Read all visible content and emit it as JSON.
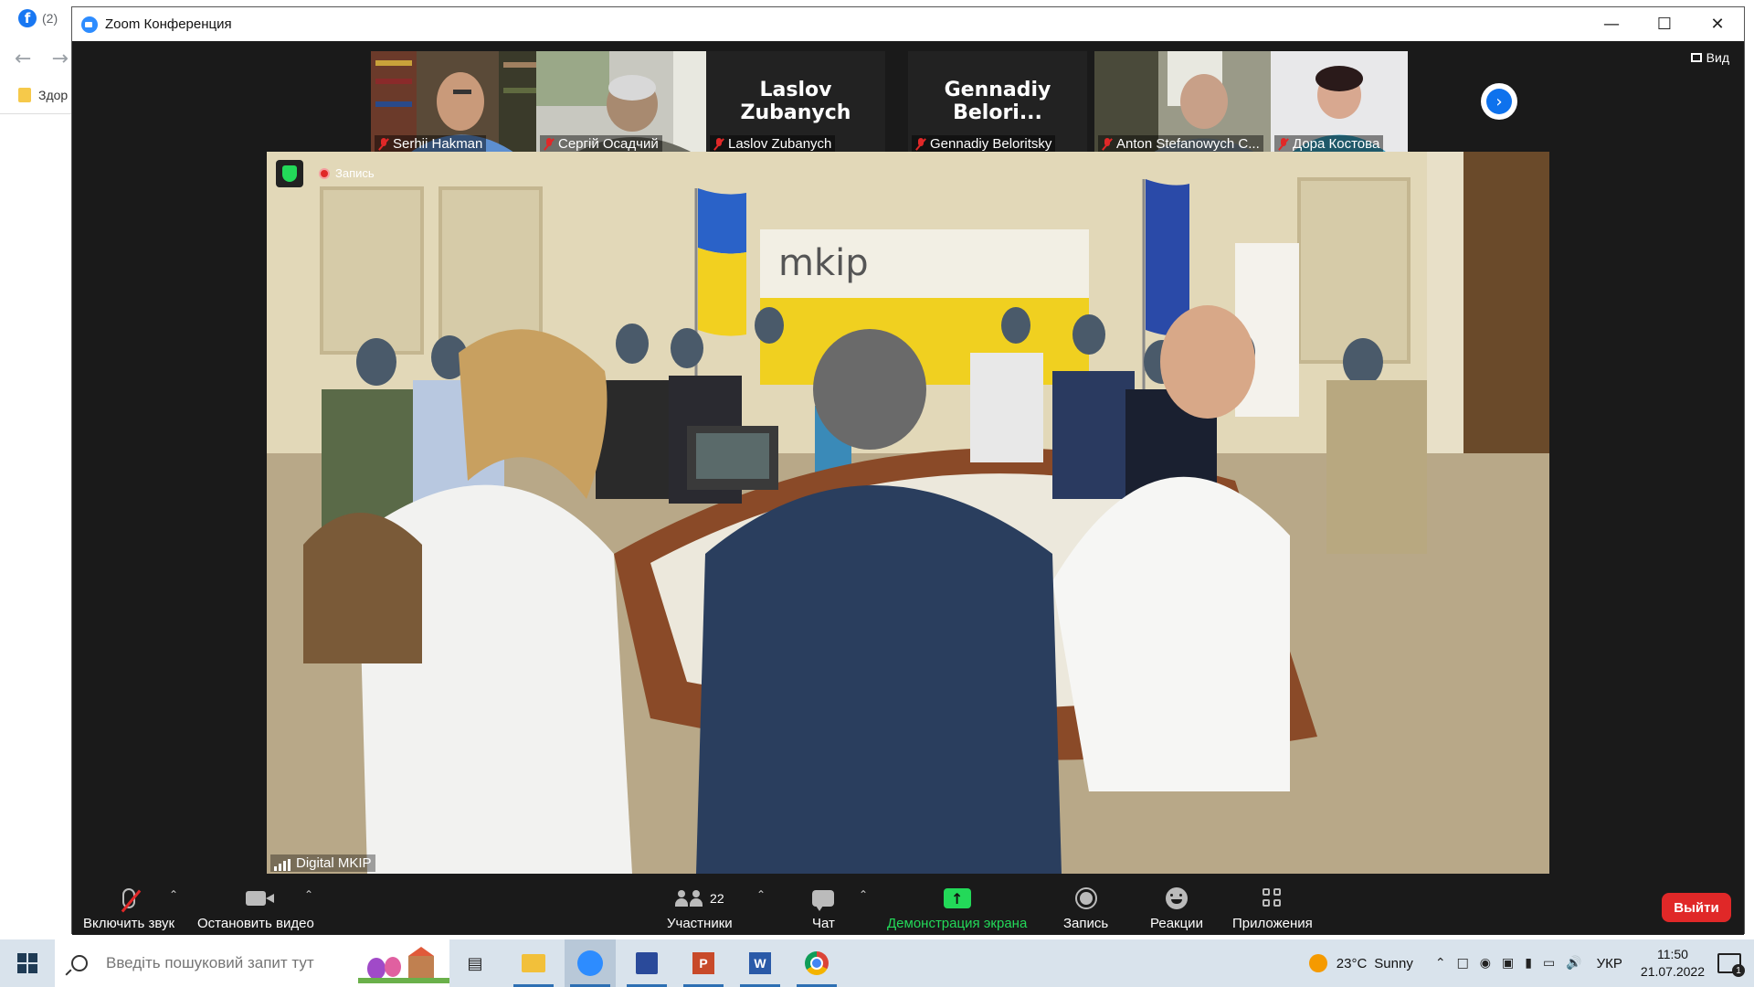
{
  "browser": {
    "tab_count": "(2)",
    "bookmark": "Здор"
  },
  "window": {
    "title": "Zoom Конференция"
  },
  "gallery": {
    "view_label": "Вид",
    "participants": [
      {
        "name": "Serhii Hakman",
        "has_video": true,
        "muted": true
      },
      {
        "name": "Сергій Осадчий",
        "has_video": true,
        "muted": true
      },
      {
        "name": "Laslov Zubanych",
        "display_name": "Laslov Zubanych",
        "has_video": false,
        "muted": true
      },
      {
        "name": "Gennadiy Beloritsky",
        "display_name": "Gennadiy Belori...",
        "has_video": false,
        "muted": true
      },
      {
        "name": "Anton Stefanowych C...",
        "has_video": true,
        "muted": true
      },
      {
        "name": "Дора Костова",
        "has_video": true,
        "muted": true
      }
    ]
  },
  "main_video": {
    "recording_label": "Запись",
    "speaker": "Digital MKIP"
  },
  "toolbar": {
    "unmute": "Включить звук",
    "stop_video": "Остановить видео",
    "participants": "Участники",
    "participants_count": "22",
    "chat": "Чат",
    "share": "Демонстрация экрана",
    "record": "Запись",
    "reactions": "Реакции",
    "apps": "Приложения",
    "leave": "Выйти"
  },
  "taskbar": {
    "search_placeholder": "Введіть пошуковий запит тут",
    "temperature": "23°C",
    "weather": "Sunny",
    "language": "УКР",
    "time": "11:50",
    "date": "21.07.2022",
    "notifications": "1"
  },
  "colors": {
    "zoom_bg": "#1a1a1a",
    "accent_blue": "#0e72ed",
    "share_green": "#23d959",
    "leave_red": "#e02828",
    "muted_red": "#e02828"
  }
}
